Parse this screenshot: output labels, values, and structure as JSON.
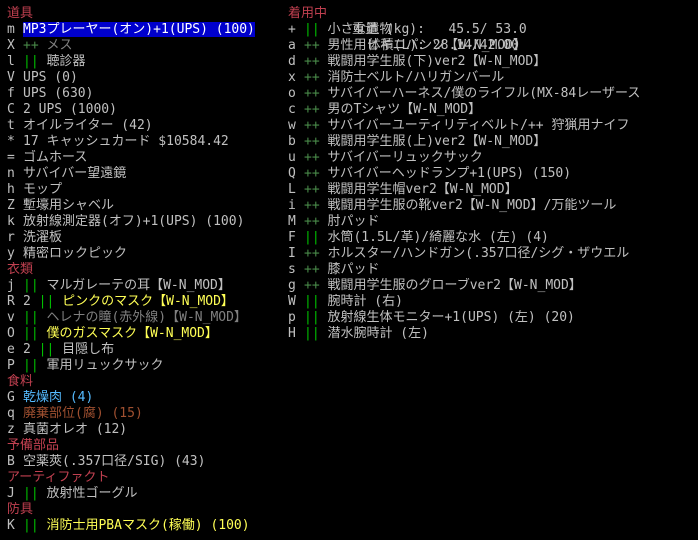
{
  "stats": {
    "weight_label": "重量 (kg):",
    "weight_value": "45.5/ 53.0",
    "volume_label": "体積(L):",
    "volume_value": "28.14/42.00"
  },
  "left_column": [
    {
      "type": "header",
      "text": "道具"
    },
    {
      "type": "item",
      "key": "m",
      "sep": "",
      "text": "MP3プレーヤー(オン)+1(UPS) (100)",
      "selected": true
    },
    {
      "type": "item",
      "key": "X",
      "sep": "++",
      "text": "メス",
      "text_color": "dim"
    },
    {
      "type": "item",
      "key": "l",
      "sep": "||",
      "text": "聴診器"
    },
    {
      "type": "item",
      "key": "V",
      "sep": "",
      "text": "UPS (0)"
    },
    {
      "type": "item",
      "key": "f",
      "sep": "",
      "text": "UPS (630)"
    },
    {
      "type": "item",
      "key": "C",
      "sep": "",
      "text": "2 UPS (1000)"
    },
    {
      "type": "item",
      "key": "t",
      "sep": "",
      "text": "オイルライター (42)"
    },
    {
      "type": "item",
      "key": "*",
      "sep": "",
      "text": "17 キャッシュカード $10584.42"
    },
    {
      "type": "item",
      "key": "=",
      "sep": "",
      "text": "ゴムホース"
    },
    {
      "type": "item",
      "key": "n",
      "sep": "",
      "text": "サバイバー望遠鏡"
    },
    {
      "type": "item",
      "key": "h",
      "sep": "",
      "text": "モップ"
    },
    {
      "type": "item",
      "key": "Z",
      "sep": "",
      "text": "塹壕用シャベル"
    },
    {
      "type": "item",
      "key": "k",
      "sep": "",
      "text": "放射線測定器(オフ)+1(UPS) (100)"
    },
    {
      "type": "item",
      "key": "r",
      "sep": "",
      "text": "洗濯板"
    },
    {
      "type": "item",
      "key": "y",
      "sep": "",
      "text": "精密ロックピック"
    },
    {
      "type": "header",
      "text": "衣類"
    },
    {
      "type": "item",
      "key": "j",
      "sep": "||",
      "text": "マルガレーテの耳【W-N_MOD】"
    },
    {
      "type": "item",
      "key": "R",
      "sep": "||",
      "prefix": "2 ",
      "text": "ピンクのマスク【W-N_MOD】",
      "text_color": "yellow"
    },
    {
      "type": "item",
      "key": "v",
      "sep": "||",
      "text": "ヘレナの瞳(赤外線)【W-N_MOD】",
      "text_color": "dim"
    },
    {
      "type": "item",
      "key": "O",
      "sep": "||",
      "text": "僕のガスマスク【W-N_MOD】",
      "text_color": "yellow"
    },
    {
      "type": "item",
      "key": "e",
      "sep": "||",
      "prefix": "2 ",
      "text": "目隠し布"
    },
    {
      "type": "item",
      "key": "P",
      "sep": "||",
      "text": "軍用リュックサック"
    },
    {
      "type": "header",
      "text": "食料"
    },
    {
      "type": "item",
      "key": "G",
      "sep": "",
      "text": "乾燥肉 (4)",
      "text_color": "cyan"
    },
    {
      "type": "item",
      "key": "q",
      "sep": "",
      "text": "廃棄部位(腐) (15)",
      "text_color": "brown"
    },
    {
      "type": "item",
      "key": "z",
      "sep": "",
      "text": "真菌オレオ (12)"
    },
    {
      "type": "header",
      "text": "予備部品"
    },
    {
      "type": "item",
      "key": "B",
      "sep": "",
      "text": "空薬莢(.357口径/SIG) (43)"
    },
    {
      "type": "header",
      "text": "アーティファクト"
    },
    {
      "type": "item",
      "key": "J",
      "sep": "||",
      "text": "放射性ゴーグル"
    },
    {
      "type": "header",
      "text": "防具"
    },
    {
      "type": "item",
      "key": "K",
      "sep": "||",
      "text": "消防士用PBAマスク(稼働) (100)",
      "text_color": "yellow"
    }
  ],
  "right_column": [
    {
      "type": "header",
      "text": "着用中"
    },
    {
      "type": "item",
      "key": "+",
      "sep": "||",
      "text": "小さな遺物"
    },
    {
      "type": "item",
      "key": "a",
      "sep": "++",
      "text": "男性用ビキニパンツ【W-N_MOD】"
    },
    {
      "type": "item",
      "key": "d",
      "sep": "++",
      "text": "戦闘用学生服(下)ver2【W-N_MOD】"
    },
    {
      "type": "item",
      "key": "x",
      "sep": "++",
      "text": "消防士ベルト/ハリガンバール"
    },
    {
      "type": "item",
      "key": "o",
      "sep": "++",
      "text": "サバイバーハーネス/僕のライフル(MX-84レーザース"
    },
    {
      "type": "item",
      "key": "c",
      "sep": "++",
      "text": "男のTシャツ【W-N_MOD】"
    },
    {
      "type": "item",
      "key": "w",
      "sep": "++",
      "text": "サバイバーユーティリティベルト/++ 狩猟用ナイフ"
    },
    {
      "type": "item",
      "key": "b",
      "sep": "++",
      "text": "戦闘用学生服(上)ver2【W-N_MOD】"
    },
    {
      "type": "item",
      "key": "u",
      "sep": "++",
      "text": "サバイバーリュックサック"
    },
    {
      "type": "item",
      "key": "Q",
      "sep": "++",
      "text": "サバイバーヘッドランプ+1(UPS) (150)"
    },
    {
      "type": "item",
      "key": "L",
      "sep": "++",
      "text": "戦闘用学生帽ver2【W-N_MOD】"
    },
    {
      "type": "item",
      "key": "i",
      "sep": "++",
      "text": "戦闘用学生服の靴ver2【W-N_MOD】/万能ツール"
    },
    {
      "type": "item",
      "key": "M",
      "sep": "++",
      "text": "肘パッド"
    },
    {
      "type": "item",
      "key": "F",
      "sep": "||",
      "text": "水筒(1.5L/革)/綺麗な水 (左) (4)"
    },
    {
      "type": "item",
      "key": "I",
      "sep": "++",
      "text": "ホルスター/ハンドガン(.357口径/シグ・ザウエル"
    },
    {
      "type": "item",
      "key": "s",
      "sep": "++",
      "text": "膝パッド"
    },
    {
      "type": "item",
      "key": "g",
      "sep": "++",
      "text": "戦闘用学生服のグローブver2【W-N_MOD】"
    },
    {
      "type": "item",
      "key": "W",
      "sep": "||",
      "text": "腕時計 (右)"
    },
    {
      "type": "item",
      "key": "p",
      "sep": "||",
      "text": "放射線生体モニター+1(UPS) (左) (20)"
    },
    {
      "type": "item",
      "key": "H",
      "sep": "||",
      "text": "潜水腕時計 (左)"
    }
  ],
  "colors": {
    "background": "#000000",
    "header": "#c04050",
    "selected_bg": "#0000cc",
    "separator": "#00c000",
    "text": "#c0c0c0",
    "yellow": "#ffff55",
    "cyan": "#55bbff",
    "brown": "#a05030"
  }
}
